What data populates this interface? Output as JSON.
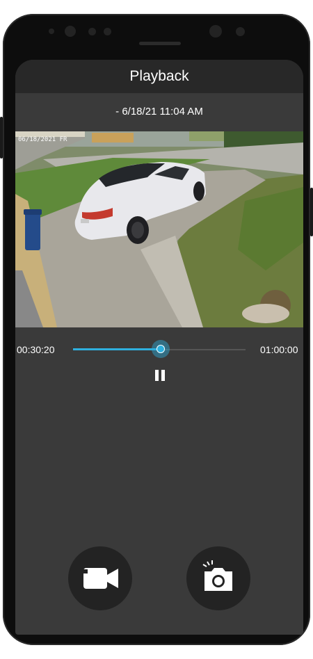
{
  "app_bar": {
    "title": "Playback"
  },
  "playback": {
    "timestamp": "- 6/18/21 11:04 AM",
    "video_overlay_text": "06/18/2021 FR",
    "current_time": "00:30:20",
    "total_time": "01:00:00",
    "progress_fraction": 0.51,
    "state": "playing"
  },
  "controls": {
    "pause_icon": "pause-icon",
    "record_icon": "video-camera-icon",
    "snapshot_icon": "camera-snapshot-icon",
    "accent_color": "#2fb0de"
  }
}
